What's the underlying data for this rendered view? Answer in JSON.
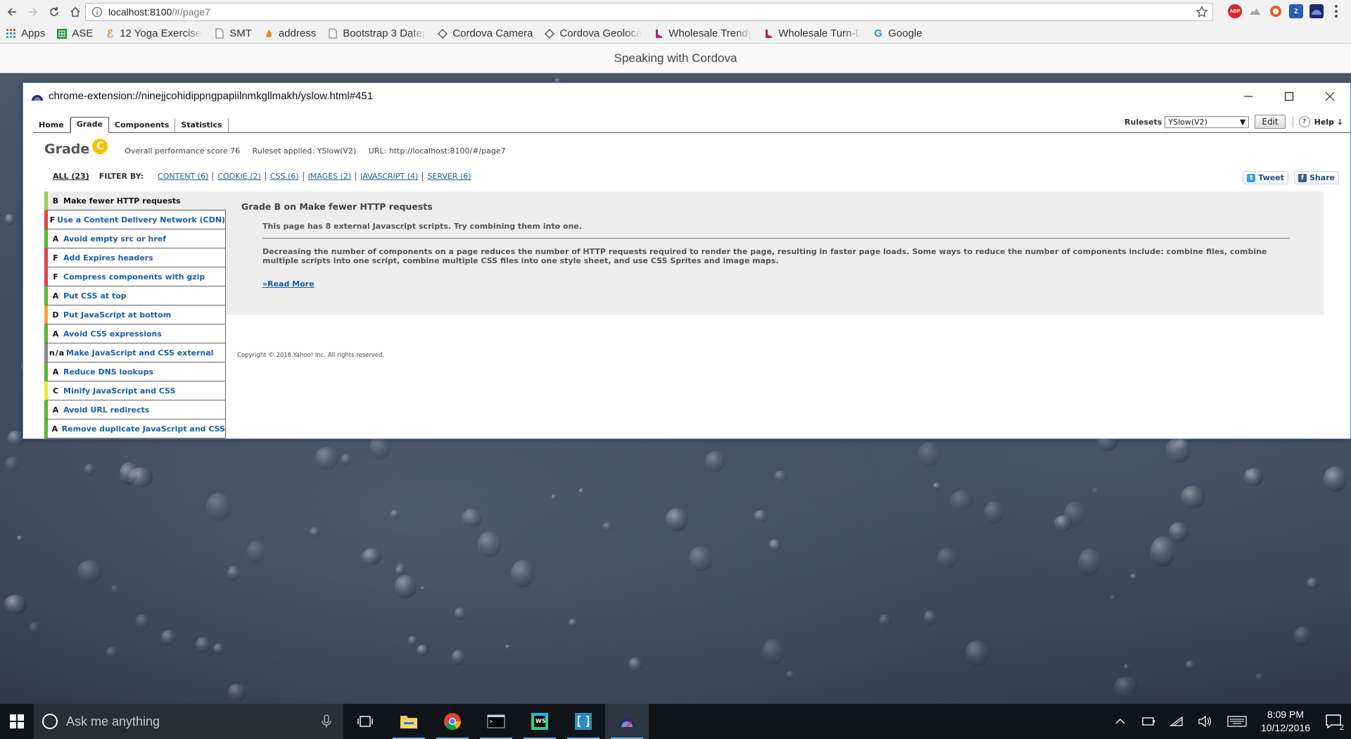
{
  "browser": {
    "url_host": "localhost:8100",
    "url_path": "/#/page7",
    "bookmarks": [
      {
        "label": "Apps",
        "icon": "apps-grid-icon"
      },
      {
        "label": "ASE",
        "icon": "spreadsheet-icon"
      },
      {
        "label": "12 Yoga Exercises",
        "icon": "yoga-icon"
      },
      {
        "label": "SMT",
        "icon": "page-icon"
      },
      {
        "label": "address",
        "icon": "fire-icon"
      },
      {
        "label": "Bootstrap 3 Datep",
        "icon": "page-icon"
      },
      {
        "label": "Cordova Camera",
        "icon": "cordova-icon"
      },
      {
        "label": "Cordova Geoloca",
        "icon": "cordova-icon"
      },
      {
        "label": "Wholesale Trendy",
        "icon": "shoe-icon"
      },
      {
        "label": "Wholesale Turn-D",
        "icon": "shoe-icon"
      },
      {
        "label": "Google",
        "icon": "google-icon"
      }
    ],
    "extensions": [
      "adblock-icon",
      "cloud-icon",
      "shield-icon",
      "z-icon",
      "yslow-icon"
    ]
  },
  "page": {
    "header_title": "Speaking with Cordova"
  },
  "popup": {
    "title": "chrome-extension://ninejjcohidippngpapiilnmkgllmakh/yslow.html#451"
  },
  "yslow": {
    "tabs": [
      "Home",
      "Grade",
      "Components",
      "Statistics"
    ],
    "active_tab": "Grade",
    "rulesets_label": "Rulesets",
    "ruleset_value": "YSlow(V2)",
    "edit_label": "Edit",
    "help_label": "Help",
    "help_arrow": "↓",
    "grade_label": "Grade",
    "grade_letter": "C",
    "score_text": "Overall performance score 76",
    "ruleset_applied": "Ruleset applied: YSlow(V2)",
    "url_text": "URL: http://localhost:8100/#/page7",
    "filter_all": "ALL (23)",
    "filter_by": "FILTER BY:",
    "filters": [
      "CONTENT (6)",
      "COOKIE (2)",
      "CSS (6)",
      "IMAGES (2)",
      "JAVASCRIPT (4)",
      "SERVER (6)"
    ],
    "tweet_label": "Tweet",
    "share_label": "Share",
    "rules": [
      {
        "grade": "B",
        "name": "Make fewer HTTP requests",
        "selected": true
      },
      {
        "grade": "F",
        "name": "Use a Content Delivery Network (CDN)"
      },
      {
        "grade": "A",
        "name": "Avoid empty src or href"
      },
      {
        "grade": "F",
        "name": "Add Expires headers"
      },
      {
        "grade": "F",
        "name": "Compress components with gzip"
      },
      {
        "grade": "A",
        "name": "Put CSS at top"
      },
      {
        "grade": "D",
        "name": "Put JavaScript at bottom"
      },
      {
        "grade": "A",
        "name": "Avoid CSS expressions"
      },
      {
        "grade": "n/a",
        "name": "Make JavaScript and CSS external"
      },
      {
        "grade": "A",
        "name": "Reduce DNS lookups"
      },
      {
        "grade": "C",
        "name": "Minify JavaScript and CSS"
      },
      {
        "grade": "A",
        "name": "Avoid URL redirects"
      },
      {
        "grade": "A",
        "name": "Remove duplicate JavaScript and CSS"
      }
    ],
    "detail": {
      "heading": "Grade B on Make fewer HTTP requests",
      "message": "This page has 8 external Javascript scripts. Try combining them into one.",
      "description": "Decreasing the number of components on a page reduces the number of HTTP requests required to render the page, resulting in faster page loads. Some ways to reduce the number of components include: combine files, combine multiple scripts into one script, combine multiple CSS files into one style sheet, and use CSS Sprites and image maps.",
      "read_more": "»Read More"
    },
    "copyright": "Copyright © 2016 Yahoo! Inc. All rights reserved."
  },
  "taskbar": {
    "search_placeholder": "Ask me anything",
    "apps": [
      "task-view-icon",
      "file-explorer-icon",
      "chrome-icon",
      "terminal-icon",
      "webstorm-icon",
      "brackets-icon",
      "yslow-icon"
    ],
    "time": "8:09 PM",
    "date": "10/12/2016",
    "notification_count": "2"
  }
}
